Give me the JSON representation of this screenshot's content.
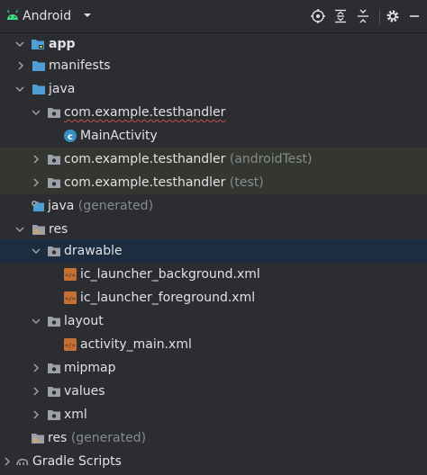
{
  "toolbar": {
    "title": "Android"
  },
  "tree": {
    "app": "app",
    "manifests": "manifests",
    "java": "java",
    "pkg_main": "com.example.testhandler",
    "main_activity": "MainActivity",
    "pkg_android_test": "com.example.testhandler",
    "android_test_suffix": "(androidTest)",
    "pkg_test": "com.example.testhandler",
    "test_suffix": "(test)",
    "java_generated": "java",
    "java_generated_suffix": "(generated)",
    "res": "res",
    "drawable": "drawable",
    "ic_bg": "ic_launcher_background.xml",
    "ic_fg": "ic_launcher_foreground.xml",
    "layout": "layout",
    "activity_main": "activity_main.xml",
    "mipmap": "mipmap",
    "values": "values",
    "xml": "xml",
    "res_generated": "res",
    "res_generated_suffix": "(generated)",
    "gradle_scripts": "Gradle Scripts"
  },
  "colors": {
    "background": "#2b2d30",
    "highlight_row": "#33372f",
    "selected_row": "#1b2d3f",
    "folder": "#4f9fd6",
    "android_green": "#3ddc84",
    "error_underline": "#c94f4f"
  }
}
